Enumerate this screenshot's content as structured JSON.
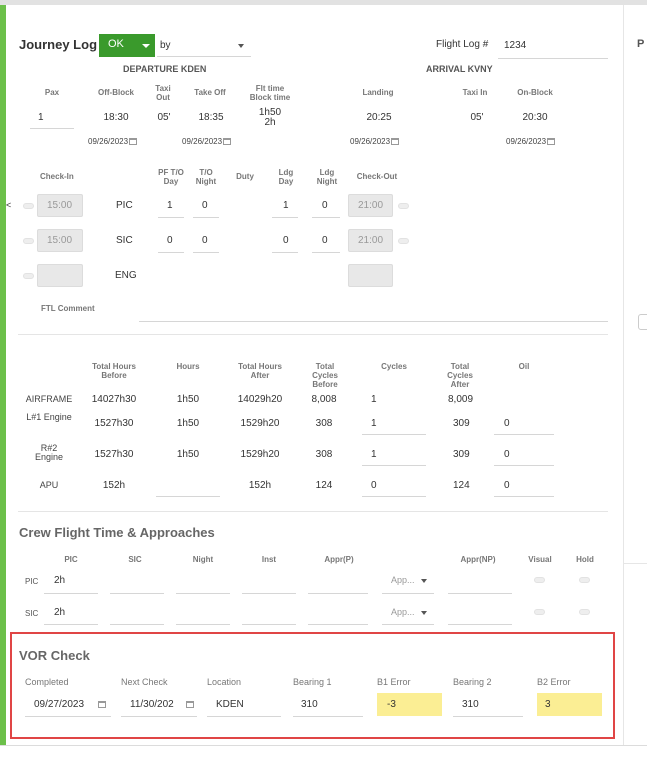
{
  "journey": {
    "title": "Journey Log",
    "status": "OK",
    "by_label": "by",
    "flight_log_label": "Flight Log #",
    "flight_log_value": "1234"
  },
  "departure": {
    "header": "DEPARTURE KDEN",
    "pax_label": "Pax",
    "pax": "1",
    "off_block_label": "Off-Block",
    "off_block": "18:30",
    "off_block_date": "09/26/2023",
    "taxi_out_label": "Taxi Out",
    "taxi_out": "05'",
    "take_off_label": "Take Off",
    "take_off": "18:35",
    "take_off_date": "09/26/2023",
    "flt_time_label": "Flt time Block time",
    "flt_time": "1h50",
    "block_time": "2h"
  },
  "arrival": {
    "header": "ARRIVAL KVNY",
    "landing_label": "Landing",
    "landing": "20:25",
    "landing_date": "09/26/2023",
    "taxi_in_label": "Taxi In",
    "taxi_in": "05'",
    "on_block_label": "On-Block",
    "on_block": "20:30",
    "on_block_date": "09/26/2023"
  },
  "duty": {
    "headers": {
      "check_in": "Check-In",
      "pf_to_day": "PF T/O Day",
      "to_night": "T/O Night",
      "duty": "Duty",
      "ldg_day": "Ldg Day",
      "ldg_night": "Ldg Night",
      "check_out": "Check-Out"
    },
    "arrow": "<",
    "rows": [
      {
        "role": "PIC",
        "check_in": "15:00",
        "pf_to_day": "1",
        "to_night": "0",
        "ldg_day": "1",
        "ldg_night": "0",
        "check_out": "21:00"
      },
      {
        "role": "SIC",
        "check_in": "15:00",
        "pf_to_day": "0",
        "to_night": "0",
        "ldg_day": "0",
        "ldg_night": "0",
        "check_out": "21:00"
      },
      {
        "role": "ENG",
        "check_in": "",
        "pf_to_day": "",
        "to_night": "",
        "ldg_day": "",
        "ldg_night": "",
        "check_out": ""
      }
    ],
    "ftl_comment_label": "FTL Comment"
  },
  "airframe": {
    "headers": {
      "total_before": "Total Hours Before",
      "hours": "Hours",
      "total_after": "Total Hours After",
      "cycles_before": "Total Cycles Before",
      "cycles": "Cycles",
      "cycles_after": "Total Cycles After",
      "oil": "Oil"
    },
    "rows": [
      {
        "name": "AIRFRAME",
        "total_before": "14027h30",
        "hours": "1h50",
        "total_after": "14029h20",
        "cycles_before": "8,008",
        "cycles": "1",
        "cycles_after": "8,009",
        "oil": ""
      },
      {
        "name": "L#1 Engine",
        "total_before": "1527h30",
        "hours": "1h50",
        "total_after": "1529h20",
        "cycles_before": "308",
        "cycles": "1",
        "cycles_after": "309",
        "oil": "0"
      },
      {
        "name": "R#2 Engine",
        "total_before": "1527h30",
        "hours": "1h50",
        "total_after": "1529h20",
        "cycles_before": "308",
        "cycles": "1",
        "cycles_after": "309",
        "oil": "0"
      },
      {
        "name": "APU",
        "total_before": "152h",
        "hours": "",
        "total_after": "152h",
        "cycles_before": "124",
        "cycles": "0",
        "cycles_after": "124",
        "oil": "0"
      }
    ]
  },
  "crew": {
    "title": "Crew Flight Time & Approaches",
    "headers": {
      "pic": "PIC",
      "sic": "SIC",
      "night": "Night",
      "inst": "Inst",
      "appr_p": "Appr(P)",
      "appr_np": "Appr(NP)",
      "visual": "Visual",
      "hold": "Hold"
    },
    "rows": [
      {
        "role": "PIC",
        "pic": "2h",
        "appr_select": "App..."
      },
      {
        "role": "SIC",
        "pic": "2h",
        "appr_select": "App..."
      }
    ]
  },
  "vor": {
    "title": "VOR Check",
    "headers": {
      "completed": "Completed",
      "next_check": "Next Check",
      "location": "Location",
      "bearing1": "Bearing 1",
      "b1_error": "B1 Error",
      "bearing2": "Bearing 2",
      "b2_error": "B2 Error"
    },
    "completed": "09/27/2023",
    "next_check": "11/30/202",
    "location": "KDEN",
    "bearing1": "310",
    "b1_error": "-3",
    "bearing2": "310",
    "b2_error": "3",
    "highlight_color": "#fbee94",
    "border_color": "#e04545"
  },
  "side": {
    "letter": "P"
  }
}
